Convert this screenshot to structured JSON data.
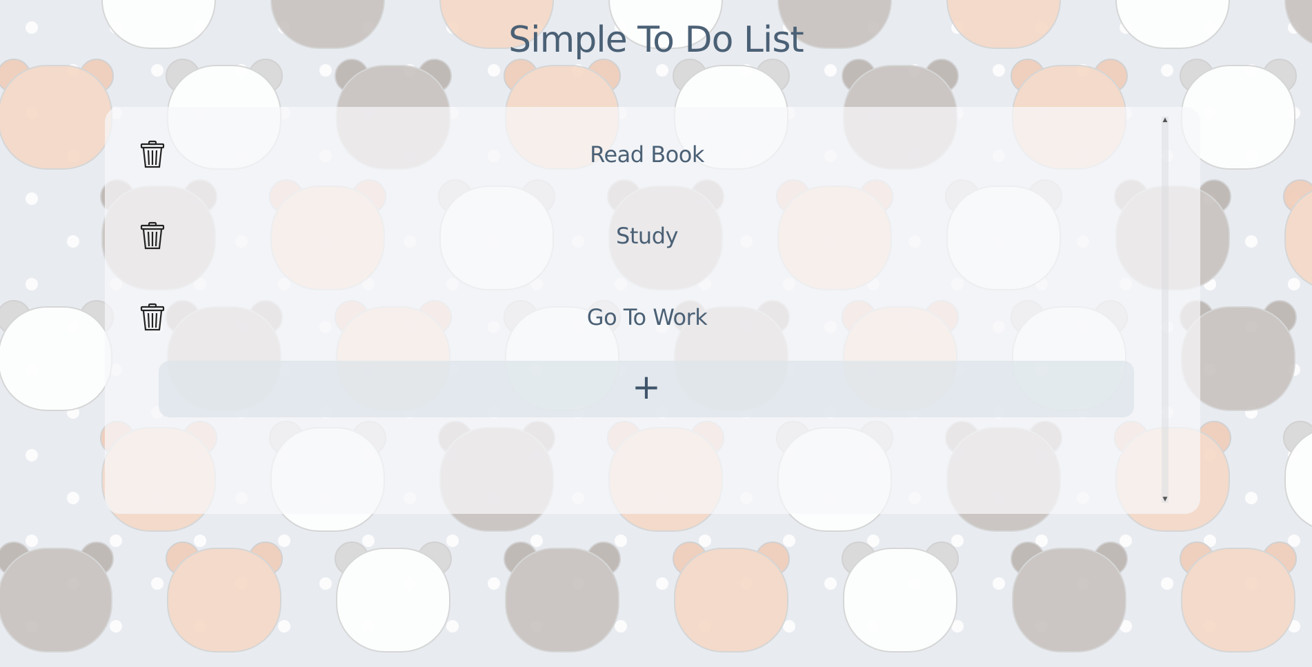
{
  "header": {
    "title": "Simple To Do List"
  },
  "todos": [
    {
      "text": "Read Book",
      "delete_icon": "trash-icon"
    },
    {
      "text": "Study",
      "delete_icon": "trash-icon"
    },
    {
      "text": "Go To Work",
      "delete_icon": "trash-icon"
    }
  ],
  "add_button": {
    "icon": "plus-icon",
    "glyph": "+"
  },
  "colors": {
    "background": "#e8ebf0",
    "title_text": "#4a6075",
    "panel": "#f6f7f9",
    "add_button_bg": "#dce4ea"
  }
}
